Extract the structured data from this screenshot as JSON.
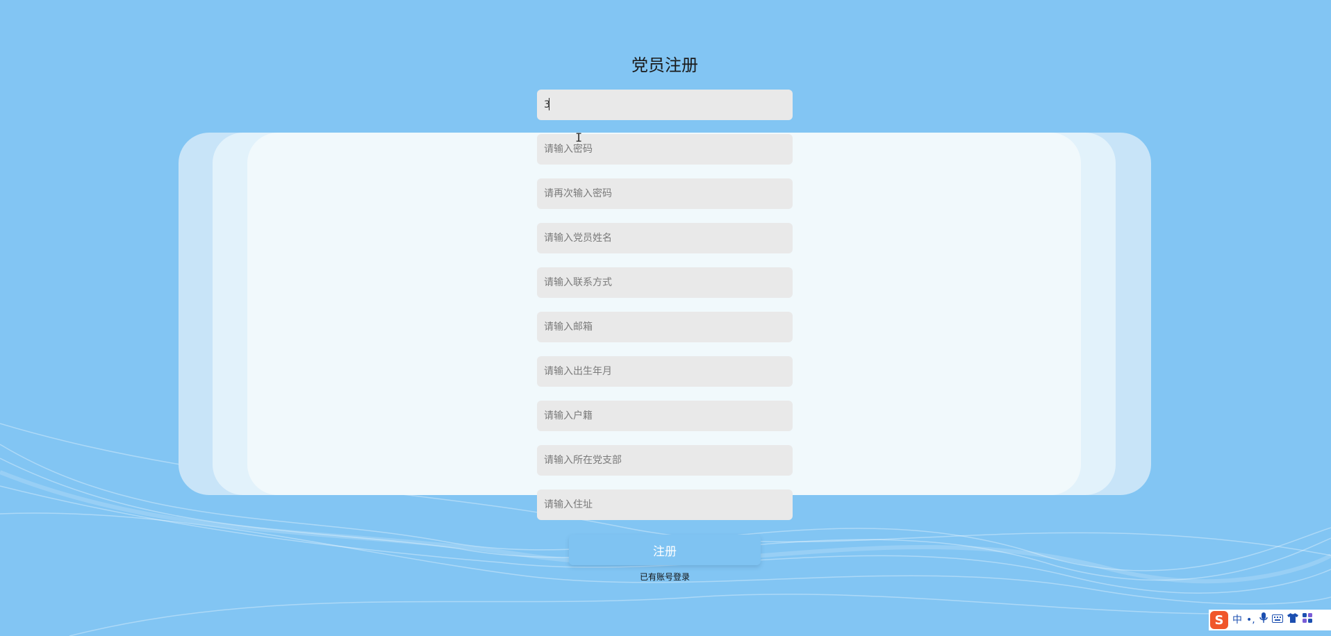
{
  "form": {
    "title": "党员注册",
    "fields": [
      {
        "value": "3",
        "placeholder": ""
      },
      {
        "value": "",
        "placeholder": "请输入密码"
      },
      {
        "value": "",
        "placeholder": "请再次输入密码"
      },
      {
        "value": "",
        "placeholder": "请输入党员姓名"
      },
      {
        "value": "",
        "placeholder": "请输入联系方式"
      },
      {
        "value": "",
        "placeholder": "请输入邮箱"
      },
      {
        "value": "",
        "placeholder": "请输入出生年月"
      },
      {
        "value": "",
        "placeholder": "请输入户籍"
      },
      {
        "value": "",
        "placeholder": "请输入所在党支部"
      },
      {
        "value": "",
        "placeholder": "请输入住址"
      }
    ],
    "submit_label": "注册",
    "login_link": "已有账号登录"
  },
  "ime_toolbar": {
    "logo": "S",
    "mode": "中",
    "punct": "•,",
    "icons": [
      "microphone-icon",
      "keyboard-icon",
      "shirt-icon",
      "grid-icon"
    ]
  },
  "colors": {
    "background": "#82c5f3",
    "panel": "#f1f9fc",
    "field_bg": "#e9e9e9",
    "button": "#7fc3f2"
  }
}
